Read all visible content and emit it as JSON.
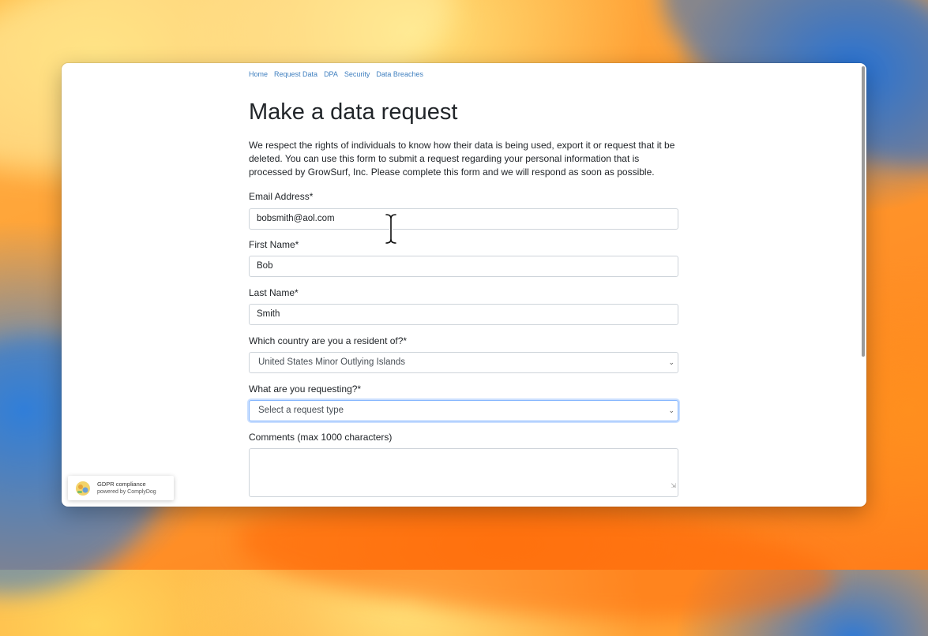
{
  "nav": {
    "items": [
      "Home",
      "Request Data",
      "DPA",
      "Security",
      "Data Breaches"
    ]
  },
  "page": {
    "title": "Make a data request",
    "intro": "We respect the rights of individuals to know how their data is being used, export it or request that it be deleted. You can use this form to submit a request regarding your personal information that is processed by GrowSurf, Inc. Please complete this form and we will respond as soon as possible."
  },
  "form": {
    "email_label": "Email Address*",
    "email_value": "bobsmith@aol.com",
    "first_name_label": "First Name*",
    "first_name_value": "Bob",
    "last_name_label": "Last Name*",
    "last_name_value": "Smith",
    "country_label": "Which country are you a resident of?*",
    "country_value": "United States Minor Outlying Islands",
    "request_label": "What are you requesting?*",
    "request_value": "Select a request type",
    "comments_label": "Comments (max 1000 characters)",
    "comments_value": ""
  },
  "badge": {
    "line1": "GDPR compliance",
    "line2": "powered by ComplyDog"
  },
  "colors": {
    "link": "#3f7fbf",
    "focus_border": "#86b7fe",
    "text": "#212529"
  },
  "icons": {
    "select_arrow": "chevron-down-icon",
    "cursor": "text-cursor-icon",
    "badge_logo": "complydog-logo-icon"
  }
}
